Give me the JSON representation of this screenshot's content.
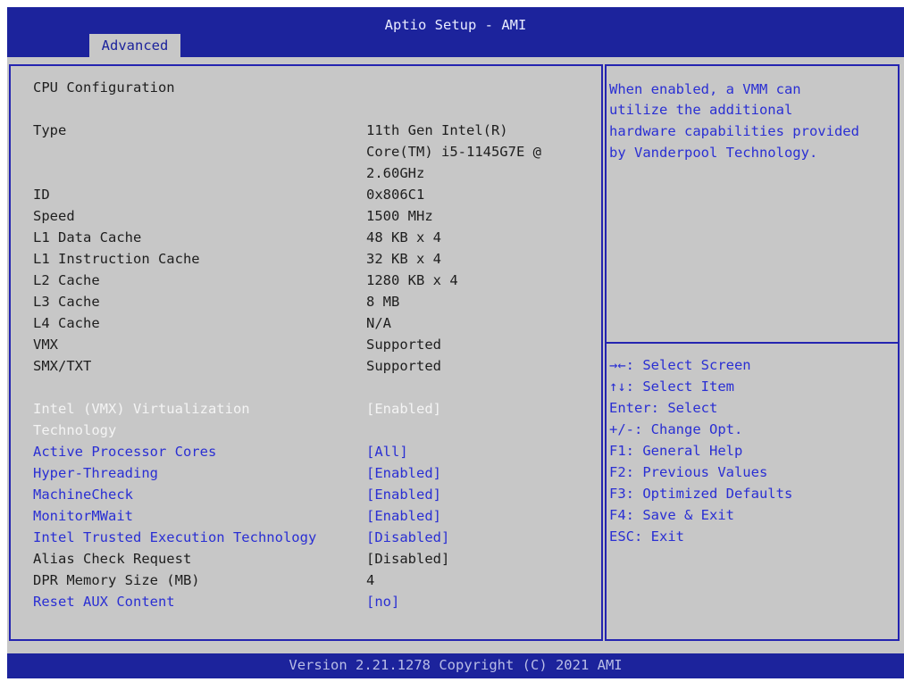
{
  "header": {
    "title": "Aptio Setup - AMI",
    "tab": "Advanced"
  },
  "section_title": "CPU Configuration",
  "info": [
    {
      "label": "Type",
      "value_lines": [
        "11th Gen Intel(R)",
        "Core(TM) i5-1145G7E @",
        "2.60GHz"
      ]
    },
    {
      "label": "ID",
      "value": "0x806C1"
    },
    {
      "label": "Speed",
      "value": "1500 MHz"
    },
    {
      "label": "L1 Data Cache",
      "value": "48 KB x 4"
    },
    {
      "label": "L1 Instruction Cache",
      "value": "32 KB x 4"
    },
    {
      "label": "L2 Cache",
      "value": "1280 KB x 4"
    },
    {
      "label": "L3 Cache",
      "value": "8 MB"
    },
    {
      "label": "L4 Cache",
      "value": "N/A"
    },
    {
      "label": "VMX",
      "value": "Supported"
    },
    {
      "label": "SMX/TXT",
      "value": "Supported"
    }
  ],
  "settings": [
    {
      "label_line1": "Intel (VMX) Virtualization",
      "label_line2": "Technology",
      "value": "[Enabled]"
    },
    {
      "label": "Active Processor Cores",
      "value": "[All]"
    },
    {
      "label": "Hyper-Threading",
      "value": "[Enabled]"
    },
    {
      "label": "MachineCheck",
      "value": "[Enabled]"
    },
    {
      "label": "MonitorMWait",
      "value": "[Enabled]"
    },
    {
      "label": "Intel Trusted Execution Technology",
      "value": "[Disabled]"
    },
    {
      "label": "Alias Check Request",
      "value": "[Disabled]"
    },
    {
      "label": "DPR Memory Size (MB)",
      "value": "4"
    },
    {
      "label": "Reset AUX Content",
      "value": "[no]"
    }
  ],
  "help_lines": [
    "When enabled, a VMM can",
    "utilize the additional",
    "hardware capabilities provided",
    "by Vanderpool Technology."
  ],
  "keys": [
    "→←: Select Screen",
    "↑↓: Select Item",
    "Enter: Select",
    "+/-: Change Opt.",
    "F1: General Help",
    "F2: Previous Values",
    "F3: Optimized Defaults",
    "F4: Save & Exit",
    "ESC: Exit"
  ],
  "footer": "Version 2.21.1278 Copyright (C) 2021 AMI"
}
